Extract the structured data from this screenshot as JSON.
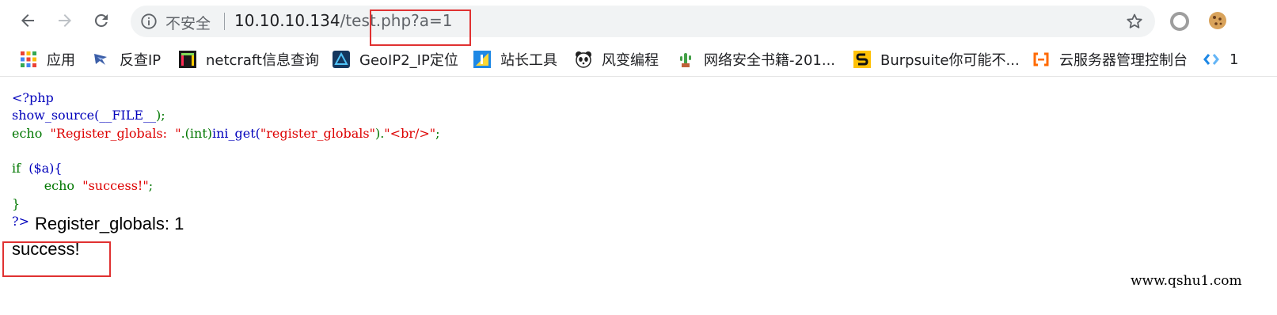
{
  "browser": {
    "security_label": "不安全",
    "url_host": "10.10.10.134",
    "url_path": "/test.php?a=1"
  },
  "bookmarks": [
    {
      "label": "应用",
      "icon": "apps-grid-icon"
    },
    {
      "label": "反查IP",
      "icon": "reverse-ip-icon"
    },
    {
      "label": "netcraft信息查询",
      "icon": "netcraft-icon"
    },
    {
      "label": "GeoIP2_IP定位",
      "icon": "geoip-icon"
    },
    {
      "label": "站长工具",
      "icon": "webmaster-tools-icon"
    },
    {
      "label": "风变编程",
      "icon": "panda-icon"
    },
    {
      "label": "网络安全书籍-201...",
      "icon": "cactus-icon"
    },
    {
      "label": "Burpsuite你可能不...",
      "icon": "burpsuite-icon"
    },
    {
      "label": "云服务器管理控制台",
      "icon": "aliyun-icon"
    },
    {
      "label": "1",
      "icon": "code-brackets-icon"
    }
  ],
  "code": {
    "line1": "<?php",
    "line2_fn": "show_source(",
    "line2_const": "__FILE__",
    "line2_end": ");",
    "line3_kw": "echo  ",
    "line3_str": "\"Register_globals:  \"",
    "line3_dot1": ".(int)",
    "line3_fn": "ini_get(",
    "line3_str2": "\"register_globals\"",
    "line3_close": ").",
    "line3_str3": "\"<br/>\"",
    "line3_semi": ";",
    "line5_kw": "if  ",
    "line5_var": "($a){",
    "line6_kw": "echo  ",
    "line6_str": "\"success!\"",
    "line6_semi": ";",
    "line7": "}",
    "close_tag": "?>"
  },
  "output": {
    "register_globals": "Register_globals: 1",
    "success": "success!"
  },
  "watermark": "www.qshu1.com",
  "colors": {
    "php_default": "#0000bb",
    "php_keyword": "#007700",
    "php_string": "#dd0000",
    "highlight_box": "#e03131"
  }
}
